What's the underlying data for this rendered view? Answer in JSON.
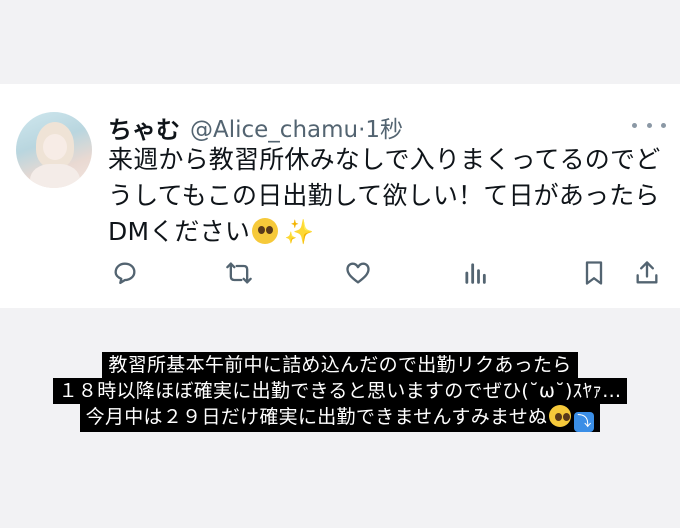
{
  "tweet": {
    "display_name": "ちゃむ",
    "handle_time": "@Alice_chamu·1秒",
    "text": "来週から教習所休みなしで入りまくってるのでどうしてもこの日出勤して欲しい！て日があったらDMください",
    "emojis": [
      "pleading-face-emoji",
      "sparkles-emoji"
    ]
  },
  "actions": [
    "reply-icon",
    "retweet-icon",
    "like-icon",
    "views-icon",
    "bookmark-icon",
    "share-icon"
  ],
  "caption": {
    "line1": "教習所基本午前中に詰め込んだので出勤リクあったら",
    "line2": "１８時以降ほぼ確実に出勤できると思いますのでぜひ(˘ω˘)ｽﾔｧ…",
    "line3": "今月中は２９日だけ確実に出勤できませんすみませぬ",
    "line3_emojis": [
      "pleading-face-emoji",
      "down-arrow-emoji"
    ]
  },
  "colors": {
    "background": "#f2f2f4",
    "card": "#ffffff",
    "text": "#0f1419",
    "secondary": "#536471",
    "caption_bg": "#000000",
    "caption_text": "#ffffff"
  }
}
